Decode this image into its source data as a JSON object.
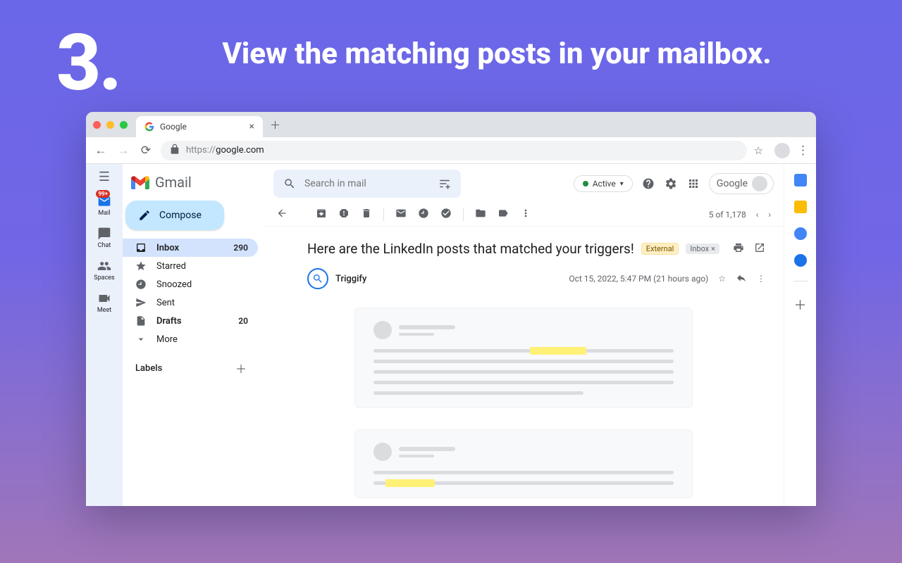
{
  "hero": {
    "step": "3.",
    "title": "View the matching posts in your mailbox."
  },
  "browser": {
    "tab_title": "Google",
    "url_protocol": "https://",
    "url_host": "google.com"
  },
  "gmail": {
    "brand": "Gmail",
    "search_placeholder": "Search in mail",
    "status": "Active",
    "google_chip": "Google",
    "compose": "Compose"
  },
  "rail": [
    {
      "label": "Mail",
      "badge": "99+"
    },
    {
      "label": "Chat"
    },
    {
      "label": "Spaces"
    },
    {
      "label": "Meet"
    }
  ],
  "nav": [
    {
      "label": "Inbox",
      "count": "290",
      "active": true
    },
    {
      "label": "Starred"
    },
    {
      "label": "Snoozed"
    },
    {
      "label": "Sent"
    },
    {
      "label": "Drafts",
      "count": "20"
    },
    {
      "label": "More"
    }
  ],
  "labels_header": "Labels",
  "toolbar": {
    "pager": "5 of 1,178"
  },
  "email": {
    "subject": "Here are the LinkedIn posts that matched your triggers!",
    "chip_external": "External",
    "chip_inbox": "Inbox",
    "sender": "Triggify",
    "timestamp": "Oct 15, 2022, 5:47 PM (21 hours ago)"
  }
}
